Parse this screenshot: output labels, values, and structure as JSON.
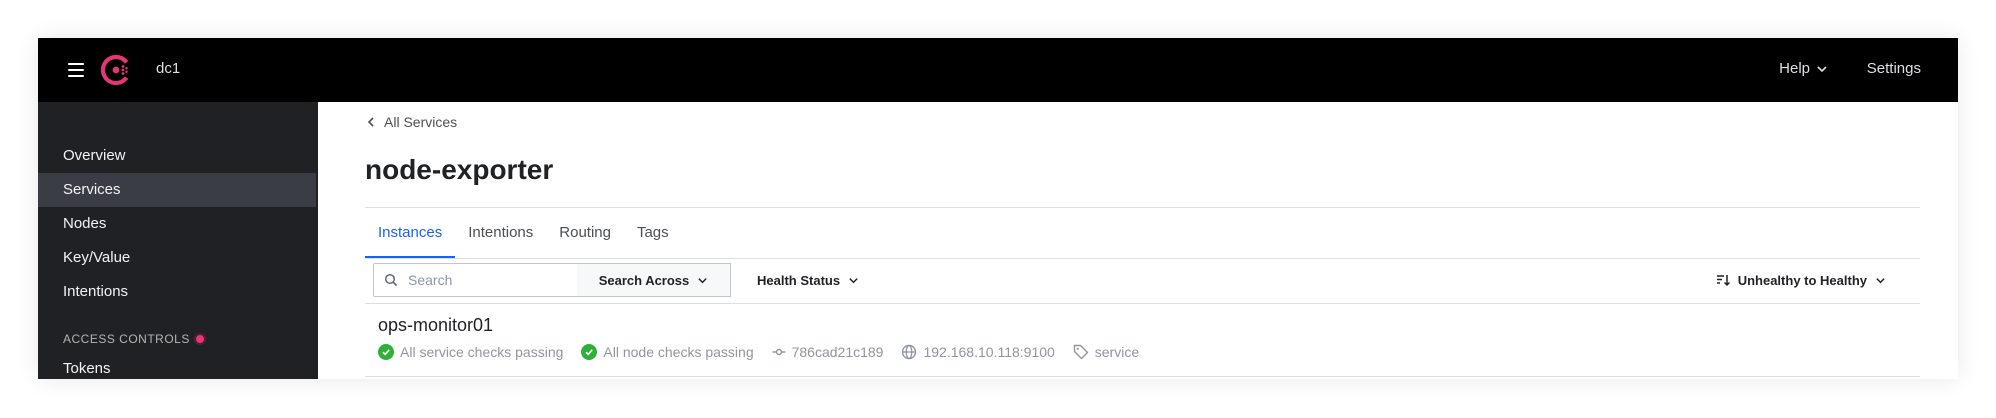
{
  "header": {
    "datacenter": "dc1",
    "help_label": "Help",
    "settings_label": "Settings"
  },
  "sidebar": {
    "items": [
      {
        "label": "Overview"
      },
      {
        "label": "Services"
      },
      {
        "label": "Nodes"
      },
      {
        "label": "Key/Value"
      },
      {
        "label": "Intentions"
      }
    ],
    "active": "Services",
    "section_label": "ACCESS CONTROLS",
    "section_items": [
      {
        "label": "Tokens"
      }
    ]
  },
  "main": {
    "breadcrumb": "All Services",
    "title": "node-exporter",
    "tabs": [
      {
        "label": "Instances"
      },
      {
        "label": "Intentions"
      },
      {
        "label": "Routing"
      },
      {
        "label": "Tags"
      }
    ],
    "active_tab": "Instances",
    "search_placeholder": "Search",
    "search_across_label": "Search Across",
    "health_status_label": "Health Status",
    "sort_label": "Unhealthy to Healthy",
    "instances": [
      {
        "name": "ops-monitor01",
        "service_checks": "All service checks passing",
        "node_checks": "All node checks passing",
        "id": "786cad21c189",
        "address": "192.168.10.118:9100",
        "tag": "service"
      }
    ]
  },
  "colors": {
    "brand": "#e03875",
    "accent": "#1563ff",
    "passing": "#2eb039",
    "topbar": "#000000",
    "sidebar": "#1f2124"
  }
}
